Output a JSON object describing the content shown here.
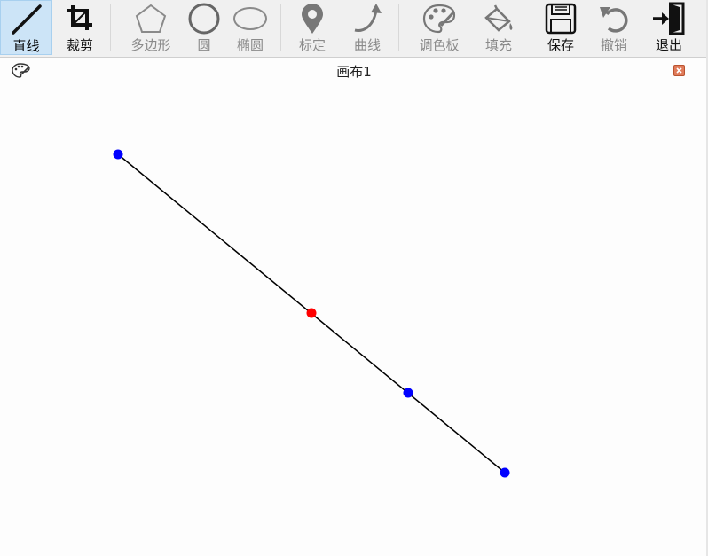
{
  "toolbar": {
    "tools": [
      {
        "id": "line",
        "label": "直线",
        "icon": "line-icon",
        "state": "active"
      },
      {
        "id": "crop",
        "label": "裁剪",
        "icon": "crop-icon",
        "state": "enabled"
      },
      {
        "id": "polygon",
        "label": "多边形",
        "icon": "pentagon-icon",
        "state": "disabled"
      },
      {
        "id": "circle",
        "label": "圆",
        "icon": "circle-icon",
        "state": "disabled"
      },
      {
        "id": "ellipse",
        "label": "椭圆",
        "icon": "ellipse-icon",
        "state": "disabled"
      },
      {
        "id": "mark",
        "label": "标定",
        "icon": "map-pin-icon",
        "state": "disabled"
      },
      {
        "id": "curve",
        "label": "曲线",
        "icon": "curve-arrow-icon",
        "state": "disabled"
      },
      {
        "id": "palette",
        "label": "调色板",
        "icon": "palette-icon",
        "state": "disabled"
      },
      {
        "id": "fill",
        "label": "填充",
        "icon": "paint-bucket-icon",
        "state": "disabled"
      },
      {
        "id": "save",
        "label": "保存",
        "icon": "floppy-disk-icon",
        "state": "enabled"
      },
      {
        "id": "undo",
        "label": "撤销",
        "icon": "undo-icon",
        "state": "disabled"
      },
      {
        "id": "exit",
        "label": "退出",
        "icon": "exit-door-icon",
        "state": "enabled"
      }
    ]
  },
  "canvas_window": {
    "title": "画布1",
    "title_icon": "palette-icon",
    "close_icon": "close-icon"
  },
  "drawing": {
    "line_color": "#000000",
    "control_point_color": "#0000ff",
    "midpoint_color": "#ff0000",
    "close_button_color": "#e07b5a",
    "active_tool_color": "#cce4f7"
  }
}
